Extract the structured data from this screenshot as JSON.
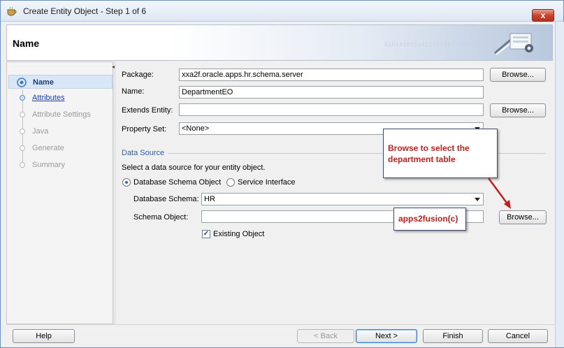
{
  "window": {
    "title": "Create Entity Object - Step 1 of 6",
    "close_label": "x"
  },
  "header": {
    "title": "Name",
    "binary_text": "0101010101010101010101010101"
  },
  "steps": [
    {
      "label": "Name",
      "state": "current"
    },
    {
      "label": "Attributes",
      "state": "link"
    },
    {
      "label": "Attribute Settings",
      "state": "disabled"
    },
    {
      "label": "Java",
      "state": "disabled"
    },
    {
      "label": "Generate",
      "state": "disabled"
    },
    {
      "label": "Summary",
      "state": "disabled"
    }
  ],
  "form": {
    "package_label": "Package:",
    "package_value": "xxa2f.oracle.apps.hr.schema.server",
    "name_label": "Name:",
    "name_value": "DepartmentEO",
    "extends_label": "Extends Entity:",
    "extends_value": "",
    "property_set_label": "Property Set:",
    "property_set_value": "<None>",
    "browse_label": "Browse..."
  },
  "datasource": {
    "section_title": "Data Source",
    "description": "Select a data source for your entity object.",
    "option_db": "Database Schema Object",
    "option_service": "Service Interface",
    "schema_label": "Database Schema:",
    "schema_value": "HR",
    "schema_object_label": "Schema Object:",
    "schema_object_value": "",
    "existing_object_label": "Existing Object",
    "existing_object_checked": true,
    "selected_option": "Database Schema Object"
  },
  "annotations": {
    "callout_text": "Browse to select the department table",
    "watermark_text": "apps2fusion(c)",
    "callout_color": "#c0201c"
  },
  "footer": {
    "help": "Help",
    "back": "< Back",
    "next": "Next >",
    "finish": "Finish",
    "cancel": "Cancel"
  }
}
